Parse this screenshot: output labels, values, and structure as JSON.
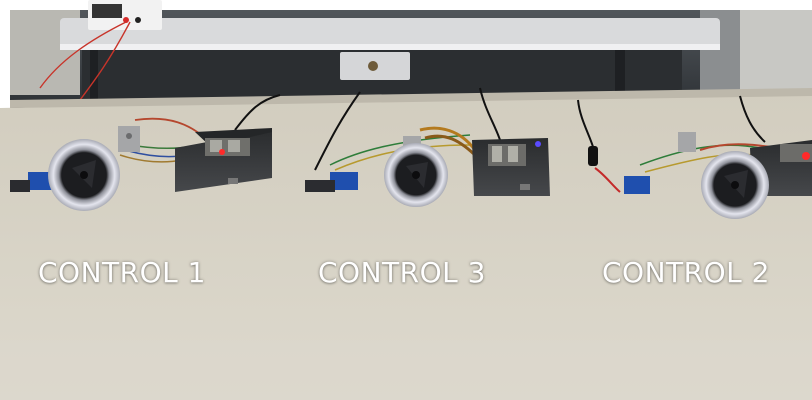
{
  "captions": {
    "control_1": "CONTROL 1",
    "control_3": "CONTROL 3",
    "control_2": "CONTROL 2"
  },
  "colors": {
    "table_surface": "#d8d3c6",
    "wall": "#3e4246",
    "caption_text": "#ffffff",
    "controller_box": "#343638",
    "wheel_tire": "#dcdde6",
    "led_red": "#ff2a2a"
  }
}
